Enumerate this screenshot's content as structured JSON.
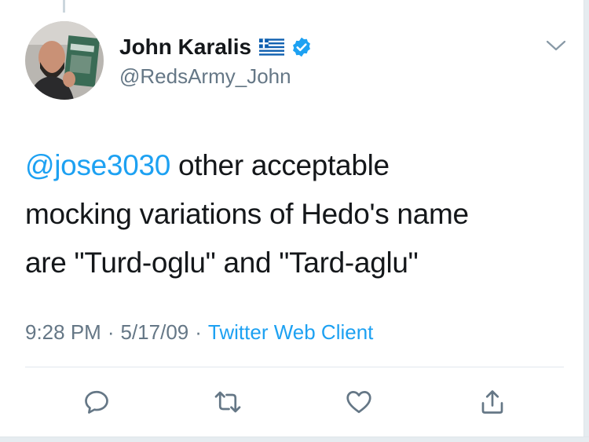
{
  "tweet": {
    "author_name": "John Karalis",
    "handle": "@RedsArmy_John",
    "verified": true,
    "text_mention": "@jose3030",
    "text_lines": [
      " other acceptable",
      "mocking variations of Hedo's name",
      "are \"Turd-oglu\" and \"Tard-aglu\""
    ],
    "time": "9:28 PM",
    "date": "5/17/09",
    "source": "Twitter Web Client",
    "separator": "·"
  },
  "icons": {
    "flag": "greece-flag-icon",
    "verified": "verified-badge-icon",
    "more": "chevron-down-icon",
    "reply": "reply-icon",
    "retweet": "retweet-icon",
    "like": "heart-icon",
    "share": "share-icon"
  },
  "colors": {
    "accent": "#1da1f2",
    "text": "#14171a",
    "secondary": "#657786",
    "divider": "#e1e8ed"
  }
}
